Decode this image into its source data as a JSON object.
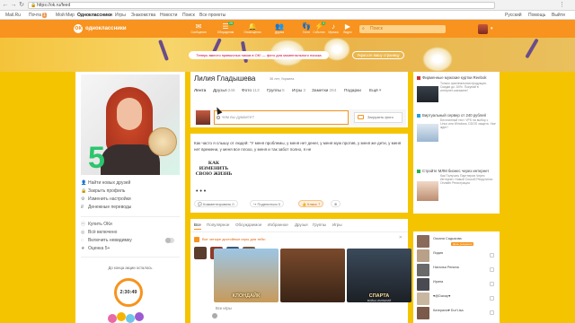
{
  "browser": {
    "url": "https://ok.ru/feed",
    "lock_icon": "lock-icon"
  },
  "bookmarks": {
    "items": [
      "Mail.Ru",
      "Почта",
      "Мой Мир",
      "Одноклассники",
      "Игры",
      "Знакомства",
      "Новости",
      "Поиск",
      "Все проекты"
    ],
    "mail_count": "1",
    "lang": "Русский",
    "help": "Помощь",
    "exit": "Выйти"
  },
  "topbar": {
    "logo": "одноклассники",
    "nav": [
      {
        "label": "Сообщения",
        "icon": "✉"
      },
      {
        "label": "Обсуждения",
        "icon": "☰",
        "badge": "25"
      },
      {
        "label": "Оповещения",
        "icon": "🔔"
      },
      {
        "label": "Друзья",
        "icon": "👥"
      },
      {
        "label": "Гости",
        "icon": "👣"
      },
      {
        "label": "События",
        "icon": "⚡",
        "badge": "3"
      },
      {
        "label": "Музыка",
        "icon": "♪"
      },
      {
        "label": "Видео",
        "icon": "▶"
      }
    ],
    "search_placeholder": "Поиск"
  },
  "banner": {
    "promo": "Теперь вместо привычных ников в OK! — фото для моментального поиска",
    "button": "Украсьте вашу страницу"
  },
  "profile": {
    "name": "Лилия Гладышева",
    "age": "36 лет, Украина",
    "menu": [
      {
        "label": "Найти новых друзей",
        "icon": "👤"
      },
      {
        "label": "Закрыть профиль",
        "icon": "🔒"
      },
      {
        "label": "Изменить настройки",
        "icon": "⚙"
      },
      {
        "label": "Денежные переводы",
        "icon": "₽"
      }
    ],
    "menu2": [
      {
        "label": "Купить ОКи",
        "icon": "ⓞ"
      },
      {
        "label": "Всё включено",
        "icon": "◎"
      },
      {
        "label": "Включить невидимку",
        "icon": "◌"
      },
      {
        "label": "Оценка 5+",
        "icon": "★"
      }
    ],
    "countdown_label": "До конца акции осталось",
    "countdown": "2:30:49"
  },
  "tabs": [
    {
      "label": "Лента",
      "count": ""
    },
    {
      "label": "Друзья",
      "count": "246"
    },
    {
      "label": "Фото",
      "count": "113"
    },
    {
      "label": "Группы",
      "count": "5"
    },
    {
      "label": "Игры",
      "count": "3"
    },
    {
      "label": "Заметки",
      "count": "284"
    },
    {
      "label": "Подарки",
      "count": ""
    },
    {
      "label": "Ещё",
      "count": "▾"
    }
  ],
  "poster": {
    "placeholder": "чем вы думаете?",
    "upload": "Загрузить фото"
  },
  "feed": {
    "text": "Как часто я слышу от людей: \"У меня проблемы, у меня нет денег, у меня муж против, у меня же дети, у меня нет времени, у меня все плохо, у меня и так забот полно, я не",
    "image_title": "КАК ИЗМЕНИТЬ СВОЮ ЖИЗНЬ",
    "more": "• • •",
    "actions": {
      "comment": "Комментировать",
      "comment_count": "0",
      "share": "Поделиться",
      "share_count": "0",
      "like": "Класс",
      "like_count": "7"
    }
  },
  "filters": [
    "Все",
    "Популярное",
    "Обсуждаемое",
    "Избранное",
    "Друзья",
    "Группы",
    "Игры"
  ],
  "games": {
    "header": "Вот четыре достойные игры для тебя:",
    "big": [
      {
        "title": "КЛОНДАЙК",
        "sub": ""
      },
      {
        "title": "",
        "sub": ""
      },
      {
        "title": "СПАРТА",
        "sub": "ВОЙНА ИМПЕРИЙ"
      }
    ],
    "all": "Все игры"
  },
  "ads": [
    {
      "title": "Фирменные мужские куртки Reebok",
      "desc": "Только оригинальная продукция. Скидки до -50%. Покупай в интернет-магазине!",
      "url": "clubsale.com.ua"
    },
    {
      "title": "Виртуальный сервер от 240 рублей",
      "desc": "Бесплатный тест. VPS на выбор с Linux или Windows. DDOS защита. Уже ждет!",
      "url": "vscale.com"
    },
    {
      "title": "Стройте МЛМ бизнес через интернет",
      "desc": "Как Получать Партнеров Через Интернет. Новый Способ Рекрутинга: Онлайн Регистрация",
      "url": "honda47otl.com"
    }
  ],
  "friends": [
    {
      "name": "Оксана Садыкова",
      "badge": "День рождения"
    },
    {
      "name": "Лидия",
      "badge": ""
    },
    {
      "name": "Наталья Репина",
      "badge": ""
    },
    {
      "name": "Ирина",
      "badge": ""
    },
    {
      "name": "♥@Danay♥",
      "badge": ""
    },
    {
      "name": "Катерина♥ Dur'Lisa",
      "badge": ""
    }
  ],
  "colors": {
    "brand": "#f7931e",
    "background": "#f5c400"
  }
}
